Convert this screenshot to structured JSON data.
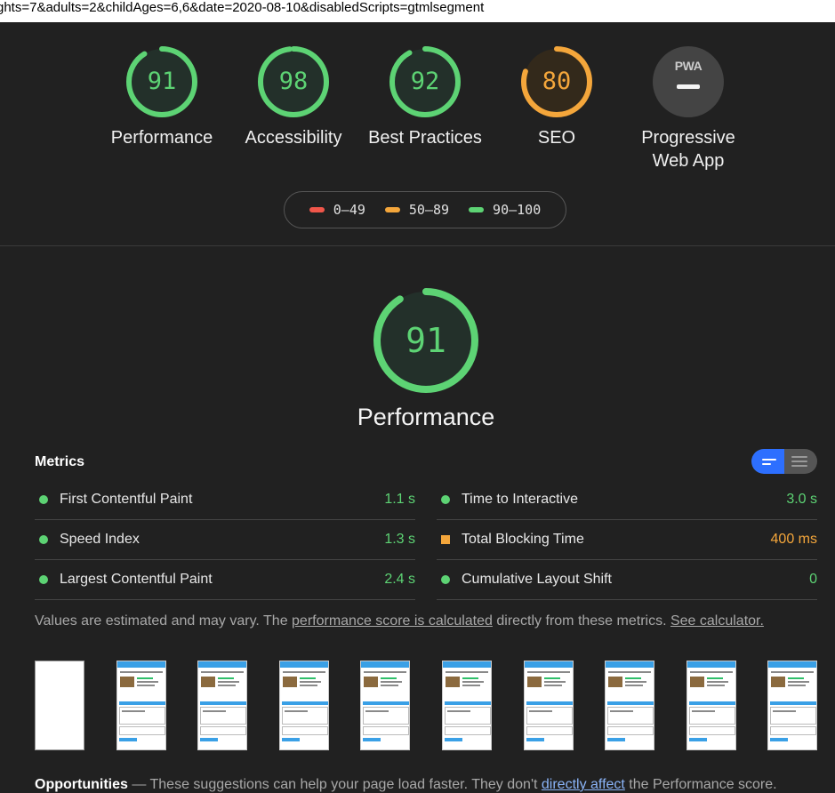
{
  "url": "ghts=7&adults=2&childAges=6,6&date=2020-08-10&disabledScripts=gtmlsegment",
  "colors": {
    "pass": "#5dd374",
    "average": "#f4a63b",
    "fail": "#f0564a",
    "bg": "#212121"
  },
  "gauges": [
    {
      "score": "91",
      "label": "Performance",
      "level": 0.91,
      "status": "pass"
    },
    {
      "score": "98",
      "label": "Accessibility",
      "level": 0.98,
      "status": "pass"
    },
    {
      "score": "92",
      "label": "Best Practices",
      "level": 0.92,
      "status": "pass"
    },
    {
      "score": "80",
      "label": "SEO",
      "level": 0.8,
      "status": "average"
    }
  ],
  "pwa": {
    "badge": "PWA",
    "label_line1": "Progressive",
    "label_line2": "Web App"
  },
  "legend": {
    "fail": "0–49",
    "average": "50–89",
    "pass": "90–100"
  },
  "perf": {
    "score": "91",
    "title": "Performance",
    "level": 0.91
  },
  "metrics": {
    "title": "Metrics",
    "left": [
      {
        "name": "First Contentful Paint",
        "value": "1.1 s",
        "status": "pass"
      },
      {
        "name": "Speed Index",
        "value": "1.3 s",
        "status": "pass"
      },
      {
        "name": "Largest Contentful Paint",
        "value": "2.4 s",
        "status": "pass"
      }
    ],
    "right": [
      {
        "name": "Time to Interactive",
        "value": "3.0 s",
        "status": "pass"
      },
      {
        "name": "Total Blocking Time",
        "value": "400 ms",
        "status": "average"
      },
      {
        "name": "Cumulative Layout Shift",
        "value": "0",
        "status": "pass"
      }
    ]
  },
  "note": {
    "prefix": "Values are estimated and may vary. The ",
    "link1": "performance score is calculated",
    "middle": " directly from these metrics. ",
    "link2": "See calculator."
  },
  "filmstrip_count": 10,
  "opportunities": {
    "title": "Opportunities",
    "dash": " — ",
    "text": "These suggestions can help your page load faster. They don't ",
    "link": "directly affect",
    "suffix": " the Performance score."
  }
}
